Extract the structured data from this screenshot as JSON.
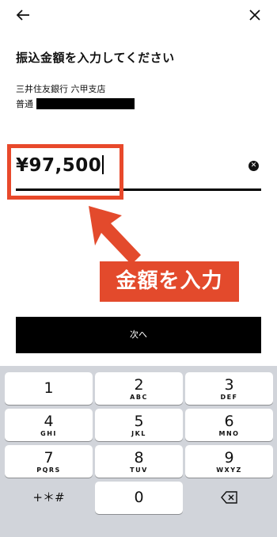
{
  "header": {
    "back_icon": "arrow-left-icon",
    "close_icon": "close-icon"
  },
  "title": "振込金額を入力してください",
  "recipient": {
    "bank_branch": "三井住友銀行 六甲支店",
    "account_type": "普通"
  },
  "amount": {
    "value": "¥97,500",
    "clear_icon": "clear-circle-icon"
  },
  "annotation": {
    "callout_label": "金額を入力",
    "color": "#e34a2c"
  },
  "next_button": {
    "label": "次へ"
  },
  "keypad": {
    "keys": [
      {
        "num": "1",
        "letters": ""
      },
      {
        "num": "2",
        "letters": "ABC"
      },
      {
        "num": "3",
        "letters": "DEF"
      },
      {
        "num": "4",
        "letters": "GHI"
      },
      {
        "num": "5",
        "letters": "JKL"
      },
      {
        "num": "6",
        "letters": "MNO"
      },
      {
        "num": "7",
        "letters": "PQRS"
      },
      {
        "num": "8",
        "letters": "TUV"
      },
      {
        "num": "9",
        "letters": "WXYZ"
      }
    ],
    "symbols_label": "+＊#",
    "zero": "0",
    "backspace_icon": "backspace-icon"
  }
}
